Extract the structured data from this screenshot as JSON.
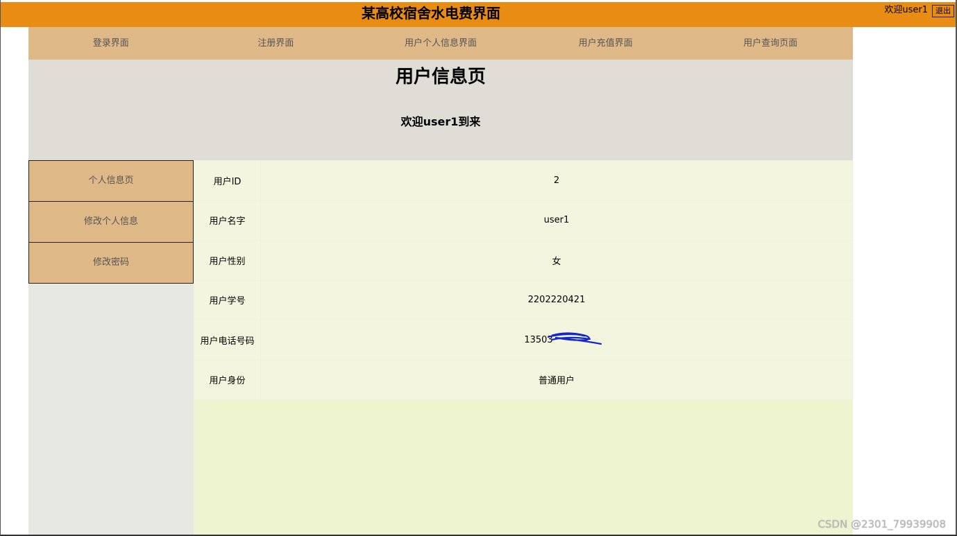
{
  "header": {
    "title": "某高校宿舍水电费界面",
    "welcome": "欢迎user1",
    "logout_label": "退出"
  },
  "topnav": {
    "items": [
      "登录界面",
      "注册界面",
      "用户个人信息界面",
      "用户充值界面",
      "用户查询页面"
    ]
  },
  "banner": {
    "title": "用户信息页",
    "subtitle": "欢迎user1到来"
  },
  "sidebar": {
    "items": [
      "个人信息页",
      "修改个人信息",
      "修改密码"
    ]
  },
  "user_info": {
    "rows": [
      {
        "label": "用户ID",
        "value": "2"
      },
      {
        "label": "用户名字",
        "value": "user1"
      },
      {
        "label": "用户性别",
        "value": "女"
      },
      {
        "label": "用户学号",
        "value": "2202220421"
      },
      {
        "label": "用户电话号码",
        "value": "13503"
      },
      {
        "label": "用户身份",
        "value": "普通用户"
      }
    ]
  },
  "watermark": "CSDN @2301_79939908",
  "colors": {
    "header_bg": "#e88c14",
    "nav_bg": "#deb887",
    "banner_bg": "#e0ddd6",
    "sidebar_bg": "#e7e8e2",
    "content_bg": "#eef4cf",
    "table_bg": "#f4f5de"
  }
}
